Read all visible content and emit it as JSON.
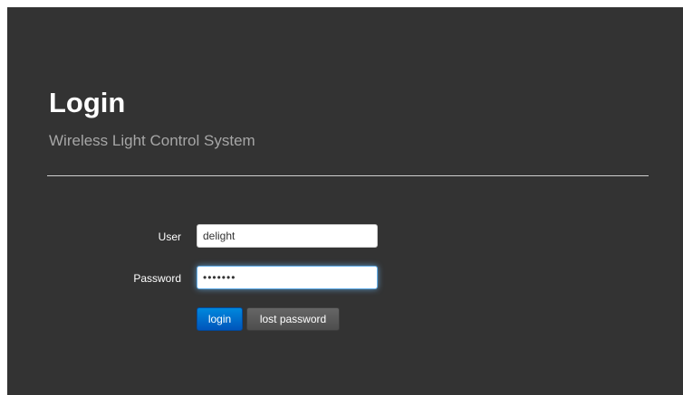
{
  "page": {
    "title": "Login",
    "subtitle": "Wireless Light Control System"
  },
  "form": {
    "user_label": "User",
    "user_value": "delight",
    "password_label": "Password",
    "password_value": "•••••••",
    "login_label": "login",
    "lost_password_label": "lost password"
  },
  "colors": {
    "panel_bg": "#333333",
    "title": "#ffffff",
    "subtitle": "#a6a6a6",
    "primary_button": "#0066cc",
    "secondary_button": "#555555",
    "focus_glow": "#66afe9"
  }
}
